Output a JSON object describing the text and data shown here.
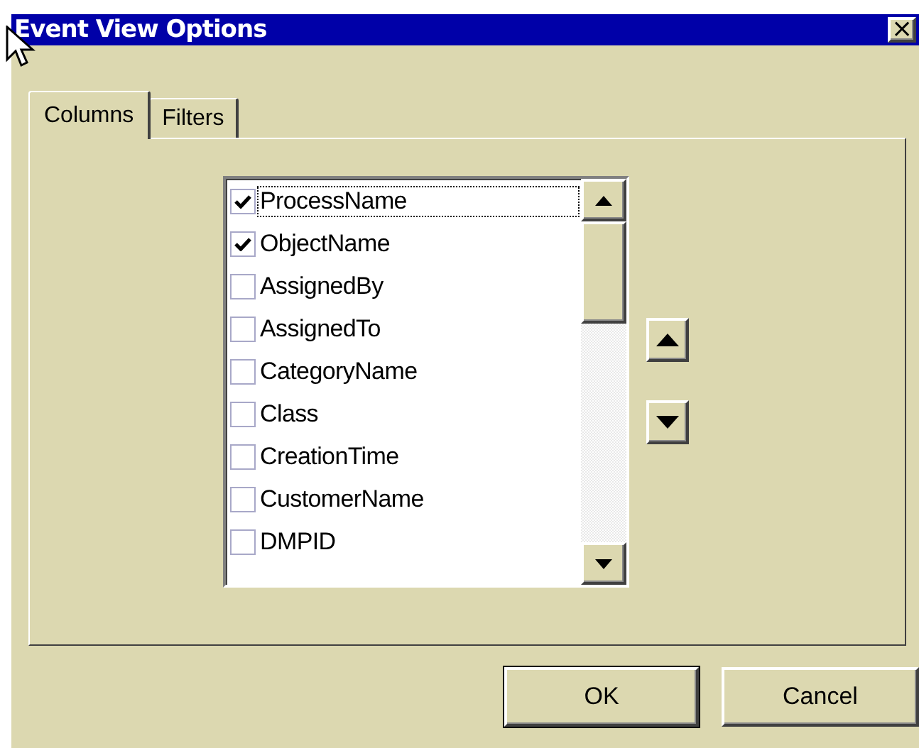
{
  "window": {
    "title": "Event View Options",
    "close": "×"
  },
  "tabs": [
    {
      "label": "Columns",
      "selected": true
    },
    {
      "label": "Filters",
      "selected": false
    }
  ],
  "columns_list": [
    {
      "label": "ProcessName",
      "checked": true,
      "focused": true
    },
    {
      "label": "ObjectName",
      "checked": true,
      "focused": false
    },
    {
      "label": "AssignedBy",
      "checked": false,
      "focused": false
    },
    {
      "label": "AssignedTo",
      "checked": false,
      "focused": false
    },
    {
      "label": "CategoryName",
      "checked": false,
      "focused": false
    },
    {
      "label": "Class",
      "checked": false,
      "focused": false
    },
    {
      "label": "CreationTime",
      "checked": false,
      "focused": false
    },
    {
      "label": "CustomerName",
      "checked": false,
      "focused": false
    },
    {
      "label": "DMPID",
      "checked": false,
      "focused": false
    }
  ],
  "buttons": [
    {
      "label": "OK",
      "kind": "default"
    },
    {
      "label": "Cancel",
      "kind": "normal"
    }
  ]
}
